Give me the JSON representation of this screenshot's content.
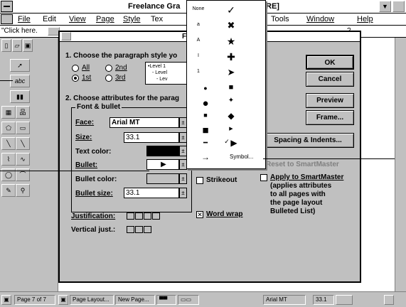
{
  "app": {
    "title": "Freelance Gra",
    "title_tail": "RE]"
  },
  "menu": {
    "items": [
      "File",
      "Edit",
      "View",
      "Page",
      "Style",
      "Tex",
      "Tools",
      "Window",
      "Help"
    ],
    "help_mark": "?"
  },
  "urow": {
    "click_text": "\"Click here."
  },
  "dialog": {
    "title_letter": "F",
    "step1": "1. Choose the paragraph style yo",
    "radios": [
      "All",
      "2nd",
      "1st",
      "3rd"
    ],
    "preview_lines": [
      "•Level 1",
      "- Level",
      "- Lev"
    ],
    "step2": "2. Choose attributes for the parag",
    "group_label": "Font & bullet",
    "face_label": "Face:",
    "face_value": "Arial MT",
    "size_label": "Size:",
    "size_value": "33.1",
    "text_color_label": "Text color:",
    "bullet_label": "Bullet:",
    "bullet_color_label": "Bullet color:",
    "bullet_size_label": "Bullet size:",
    "bullet_size_value": "33.1",
    "strikeout_label": "Strikeout",
    "justification_label": "Justification:",
    "vertical_label": "Vertical just.:",
    "word_wrap_label": "Word wrap",
    "ok": "OK",
    "cancel": "Cancel",
    "preview": "Preview",
    "frame": "Frame...",
    "spacing": "Spacing & Indents...",
    "reset": "Reset to SmartMaster",
    "apply": "Apply to SmartMaster",
    "apply_note": [
      "(applies attributes",
      "to all pages with",
      "the page layout",
      "Bulleted List)"
    ]
  },
  "bullet_menu": {
    "left": [
      "None",
      "a",
      "A",
      "I",
      "1",
      "●",
      "●",
      "■",
      "■",
      "━",
      "→"
    ],
    "right": [
      "✓",
      "✖",
      "★",
      "✚",
      "➤",
      "■",
      "✦",
      "◆",
      "▶",
      "▶",
      "Symbol..."
    ]
  },
  "status": {
    "page": "Page 7 of 7",
    "layout": "Page Layout...",
    "newpage": "New Page...",
    "font": "Arial MT",
    "size": "33.1"
  },
  "tools": {
    "abc": "abc"
  }
}
